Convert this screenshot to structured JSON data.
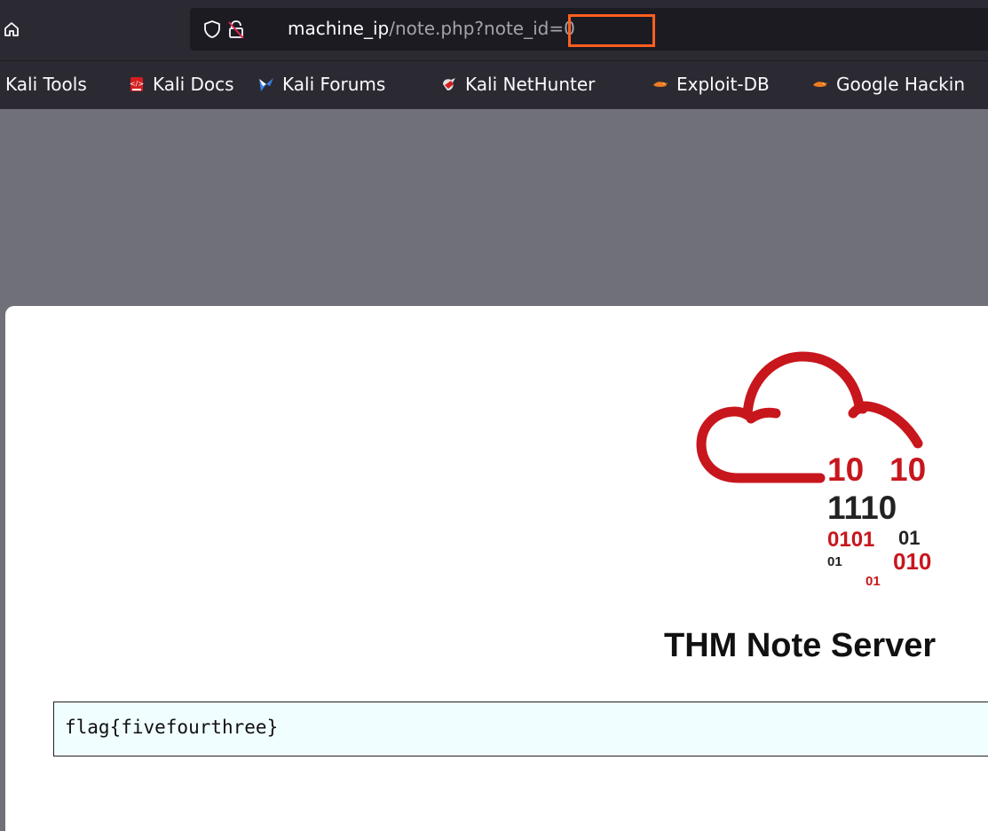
{
  "browser": {
    "url_host": "machine_ip",
    "url_path": "/note.php?note_id=0",
    "highlight_color": "#ff5f1f",
    "home_icon": "home-icon",
    "shield_icon": "shield-icon",
    "lock_icon": "insecure-lock-icon"
  },
  "bookmarks": [
    {
      "label": "Kali Tools",
      "icon": "none"
    },
    {
      "label": "Kali Docs",
      "icon": "kali-docs-icon"
    },
    {
      "label": "Kali Forums",
      "icon": "kali-forums-icon"
    },
    {
      "label": "Kali NetHunter",
      "icon": "kali-nethunter-icon"
    },
    {
      "label": "Exploit-DB",
      "icon": "exploit-db-icon"
    },
    {
      "label": "Google Hackin",
      "icon": "exploit-db-icon"
    }
  ],
  "page": {
    "logo": {
      "cloud_color": "#c8161d",
      "lines": [
        "10",
        "10",
        "1110",
        "0101",
        "01",
        "01",
        "010",
        "01"
      ]
    },
    "title": "THM Note Server",
    "note": "flag{fivefourthree}"
  }
}
